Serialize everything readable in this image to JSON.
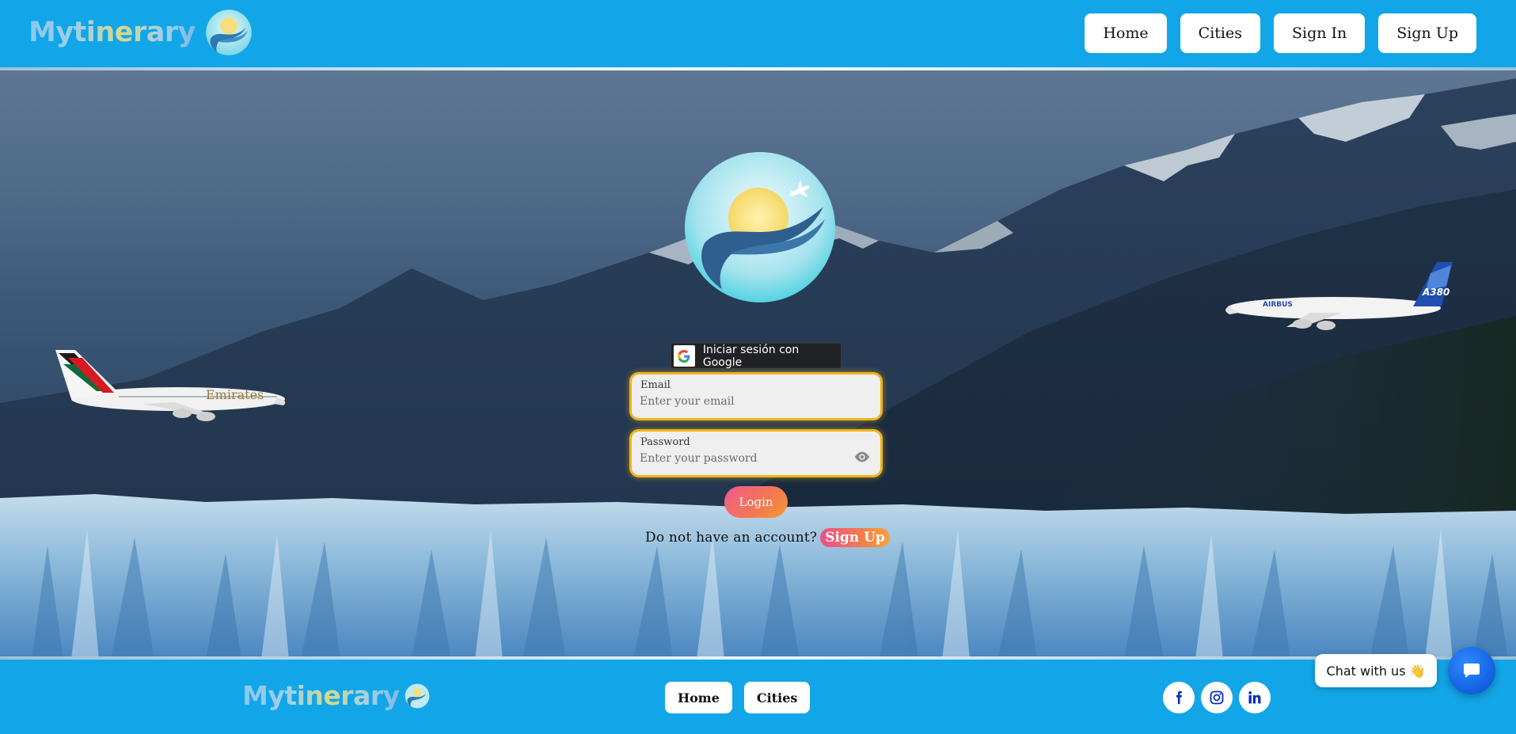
{
  "header": {
    "brand": "Mytinerary",
    "nav": [
      {
        "label": "Home"
      },
      {
        "label": "Cities"
      },
      {
        "label": "Sign In"
      },
      {
        "label": "Sign Up"
      }
    ]
  },
  "hero": {
    "plane_left_livery": "Emirates",
    "plane_right_livery": "A380",
    "plane_right_brand": "AIRBUS"
  },
  "login": {
    "google_label": "Iniciar sesión con Google",
    "email": {
      "label": "Email",
      "placeholder": "Enter your email",
      "value": ""
    },
    "password": {
      "label": "Password",
      "placeholder": "Enter your password",
      "value": ""
    },
    "submit_label": "Login",
    "signup_prompt": "Do not have an account?",
    "signup_link": "Sign Up"
  },
  "footer": {
    "brand": "Mytinerary",
    "nav": [
      {
        "label": "Home"
      },
      {
        "label": "Cities"
      }
    ],
    "socials": [
      {
        "icon": "facebook-icon"
      },
      {
        "icon": "instagram-icon"
      },
      {
        "icon": "linkedin-icon"
      }
    ]
  },
  "chat": {
    "label": "Chat with us",
    "emoji": "👋"
  },
  "colors": {
    "brand_blue": "#12a6e8",
    "field_border": "#f0b418",
    "chat_blue": "#1565e6",
    "login_gradient_start": "#ee5a8f",
    "login_gradient_end": "#f79a3a"
  }
}
